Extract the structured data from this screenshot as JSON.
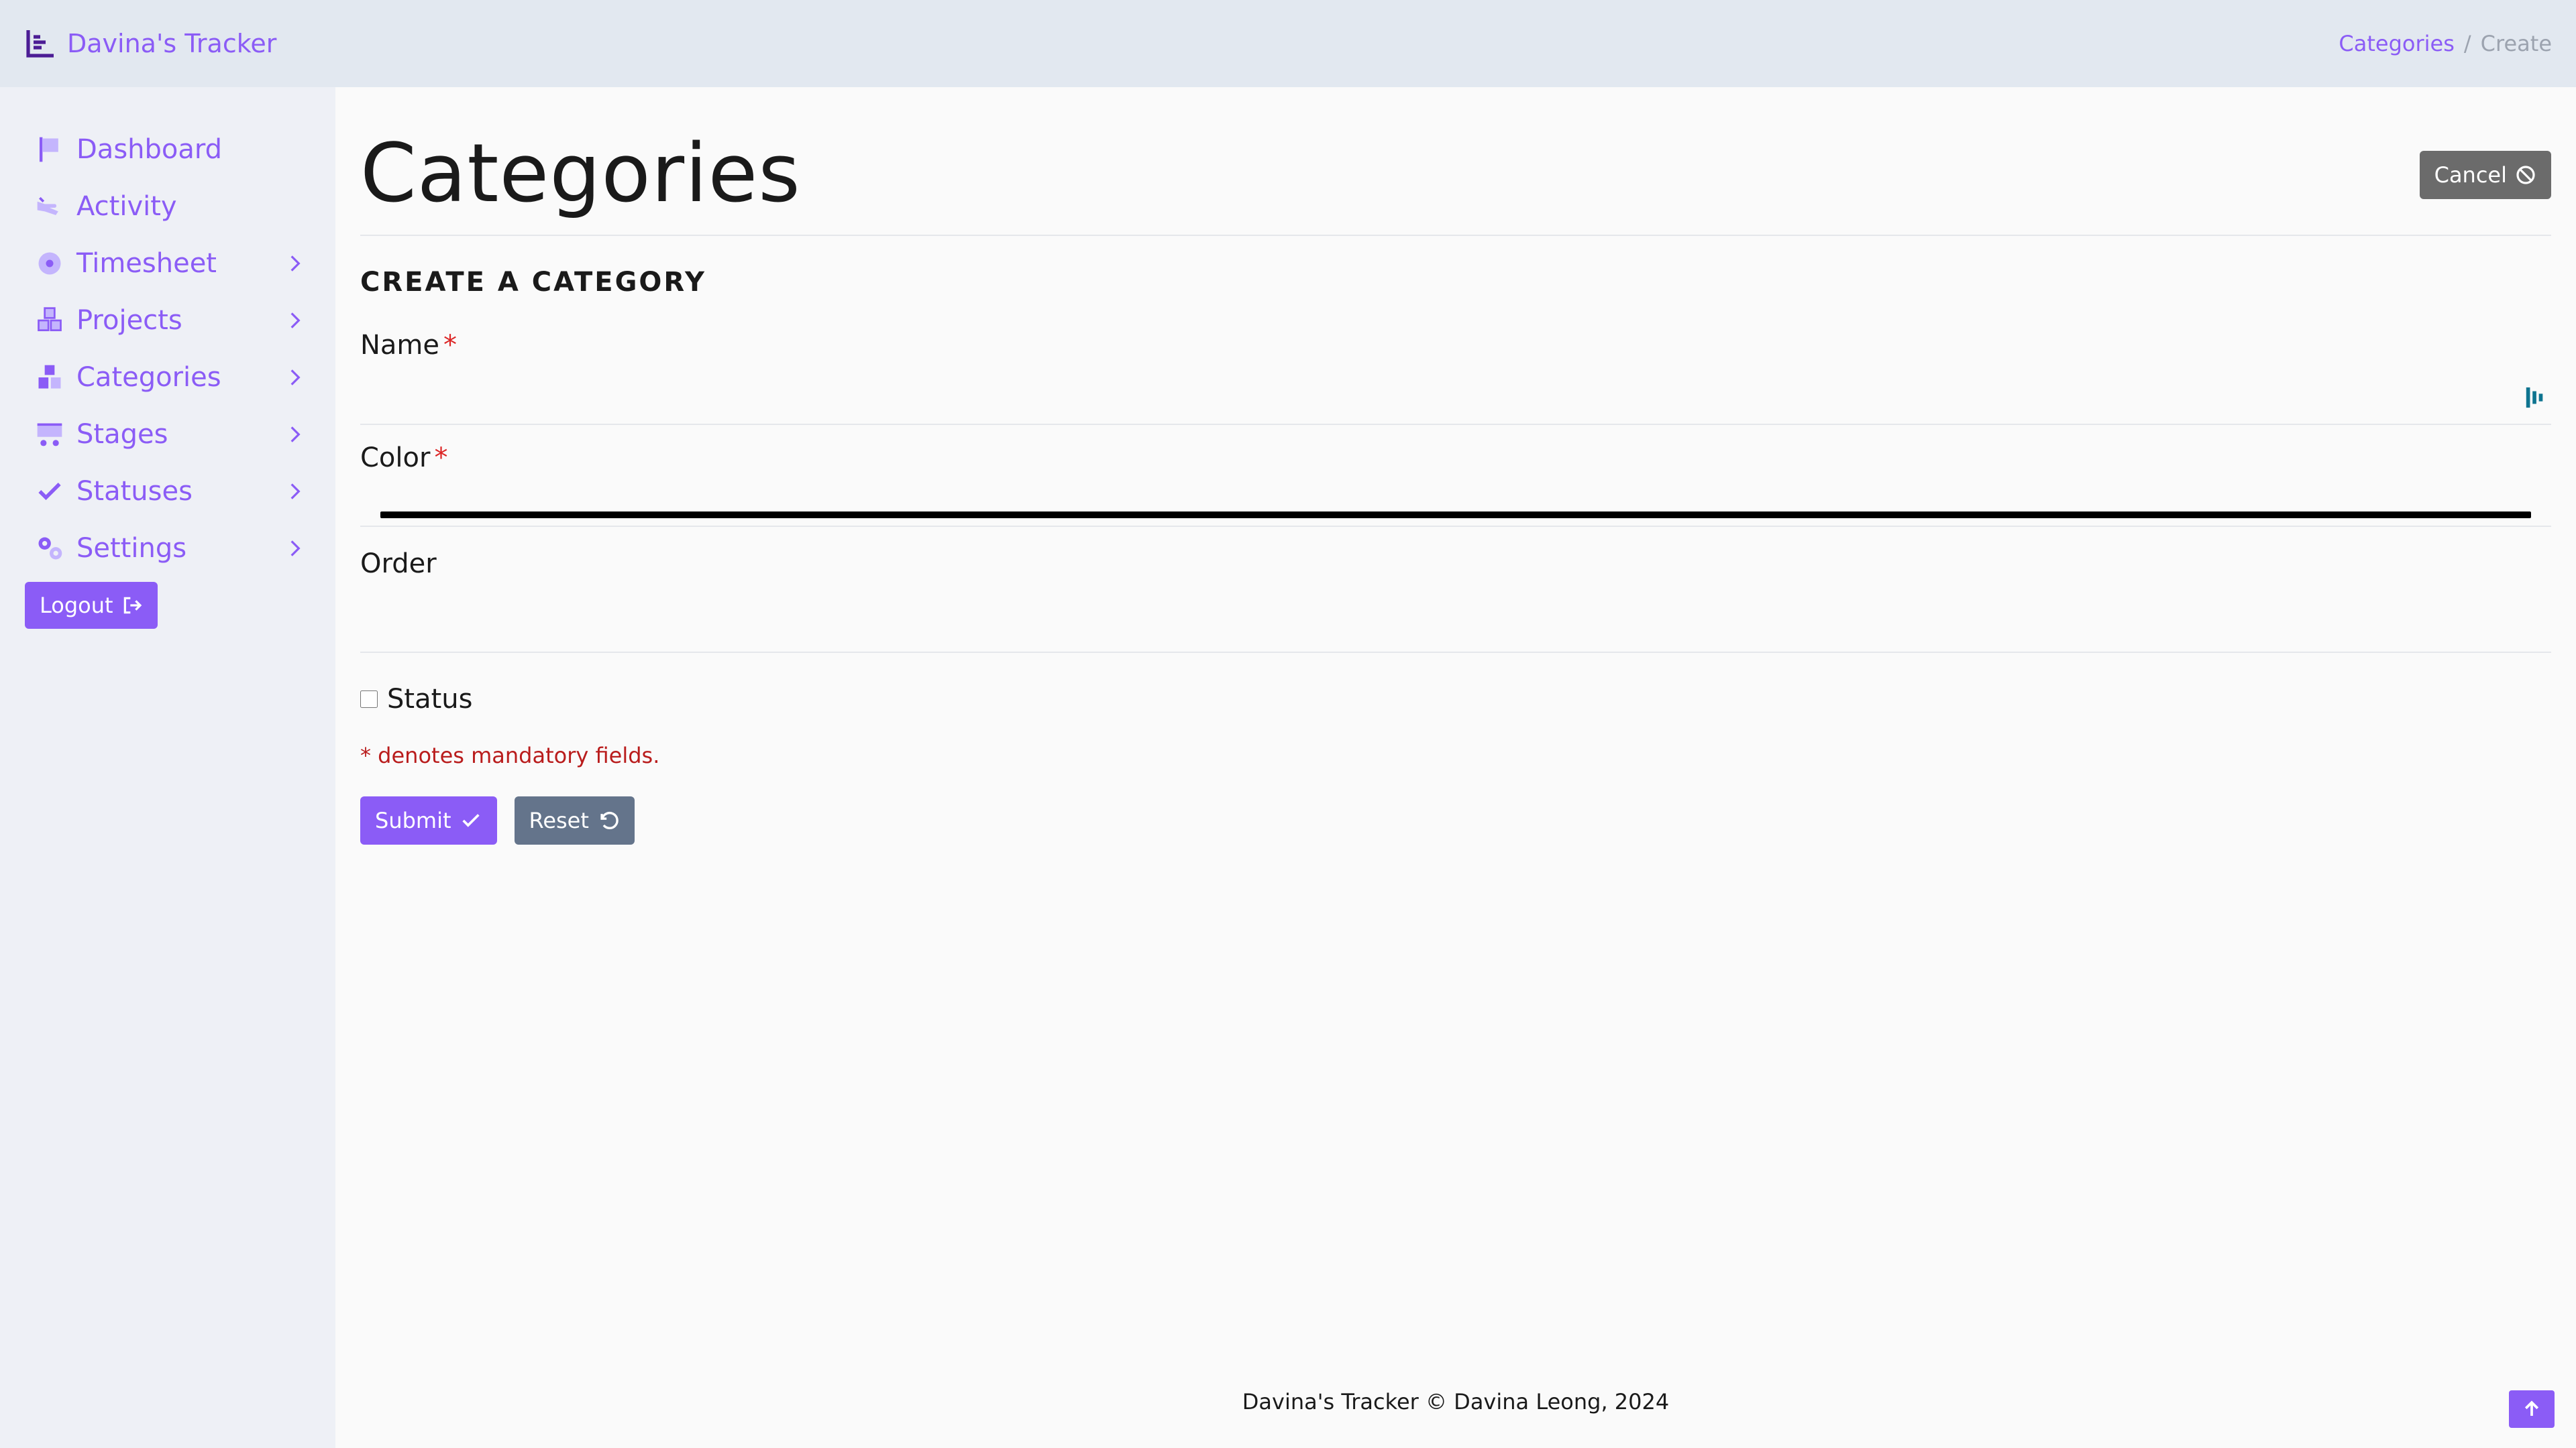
{
  "app": {
    "brand": "Davina's Tracker"
  },
  "breadcrumb": {
    "parent": "Categories",
    "separator": "/",
    "current": "Create"
  },
  "sidebar": {
    "items": [
      {
        "label": "Dashboard",
        "icon": "flag-icon",
        "has_submenu": false
      },
      {
        "label": "Activity",
        "icon": "hand-icon",
        "has_submenu": false
      },
      {
        "label": "Timesheet",
        "icon": "disc-icon",
        "has_submenu": true
      },
      {
        "label": "Projects",
        "icon": "cubes-icon",
        "has_submenu": true
      },
      {
        "label": "Categories",
        "icon": "boxes-icon",
        "has_submenu": true
      },
      {
        "label": "Stages",
        "icon": "cart-icon",
        "has_submenu": true
      },
      {
        "label": "Statuses",
        "icon": "check-icon",
        "has_submenu": true
      },
      {
        "label": "Settings",
        "icon": "gears-icon",
        "has_submenu": true
      }
    ],
    "logout_label": "Logout"
  },
  "main": {
    "title": "Categories",
    "cancel_label": "Cancel",
    "section_title": "CREATE A CATEGORY",
    "fields": {
      "name": {
        "label": "Name",
        "required_mark": "*",
        "value": ""
      },
      "color": {
        "label": "Color",
        "required_mark": "*",
        "value": "#000000"
      },
      "order": {
        "label": "Order",
        "value": ""
      }
    },
    "status_label": "Status",
    "status_checked": false,
    "mandatory_note": "* denotes mandatory fields.",
    "submit_label": "Submit",
    "reset_label": "Reset"
  },
  "footer": {
    "text": "Davina's Tracker © Davina Leong, 2024"
  },
  "colors": {
    "accent": "#8b5cf6",
    "topbar": "#e2e8f0",
    "sidebar": "#eef0f6",
    "required": "#dc2626",
    "reset": "#64748b",
    "cancel": "#6b6b6b"
  }
}
